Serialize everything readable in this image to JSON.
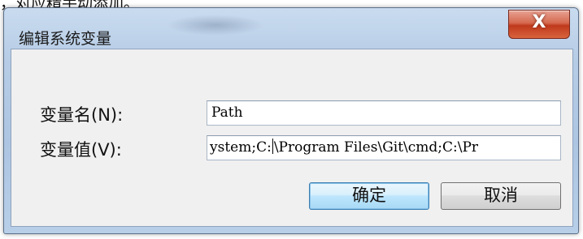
{
  "background_fragment": "，对应精手动添加。",
  "dialog": {
    "title": "编辑系统变量",
    "close_glyph": "X",
    "variable_name": {
      "label": "变量名(N):",
      "value": "Path"
    },
    "variable_value": {
      "label": "变量值(V):",
      "value_before_caret": "ystem;C:",
      "value_after_caret": "\\Program Files\\Git\\cmd;C:\\Pr"
    },
    "buttons": {
      "ok": "确定",
      "cancel": "取消"
    }
  }
}
